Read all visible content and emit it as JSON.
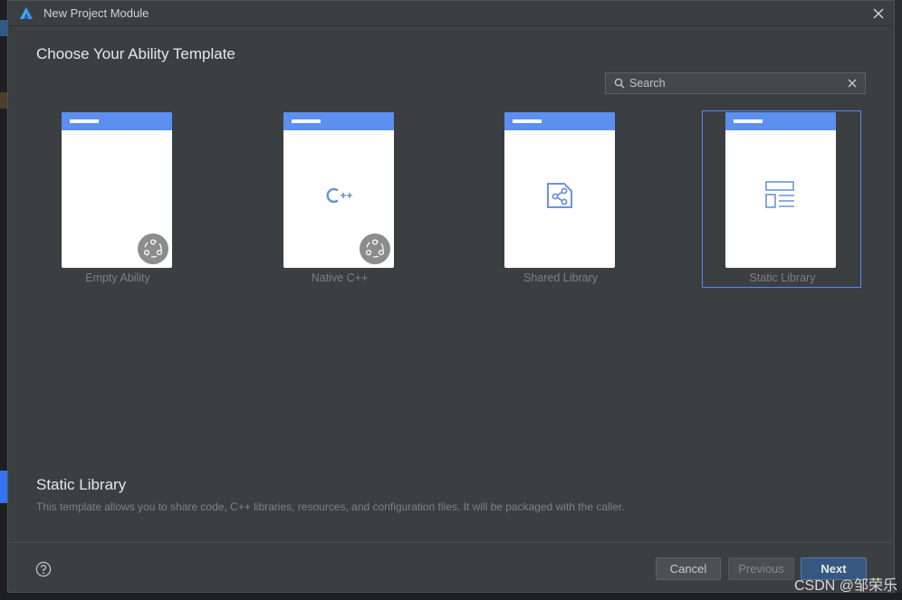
{
  "window": {
    "title": "New Project Module"
  },
  "heading": "Choose Your Ability Template",
  "search": {
    "placeholder": "Search",
    "value": ""
  },
  "templates": [
    {
      "label": "Empty Ability",
      "icon": "blank-page-icon",
      "badge": "ability-badge-icon",
      "selected": false
    },
    {
      "label": "Native C++",
      "icon": "cpp-icon",
      "badge": "ability-badge-icon",
      "selected": false
    },
    {
      "label": "Shared Library",
      "icon": "shared-library-icon",
      "selected": false
    },
    {
      "label": "Static Library",
      "icon": "static-library-icon",
      "selected": true
    }
  ],
  "description": {
    "title": "Static Library",
    "text": "This template allows you to share code, C++ libraries, resources, and configuration files. It will be packaged with the caller."
  },
  "buttons": {
    "cancel": "Cancel",
    "previous": "Previous",
    "next": "Next"
  },
  "watermark": "CSDN @邹荣乐",
  "colors": {
    "accent": "#5b8ff0",
    "selection_border": "#548af7",
    "primary_button": "#365880",
    "dialog_bg": "#3c3f41"
  }
}
